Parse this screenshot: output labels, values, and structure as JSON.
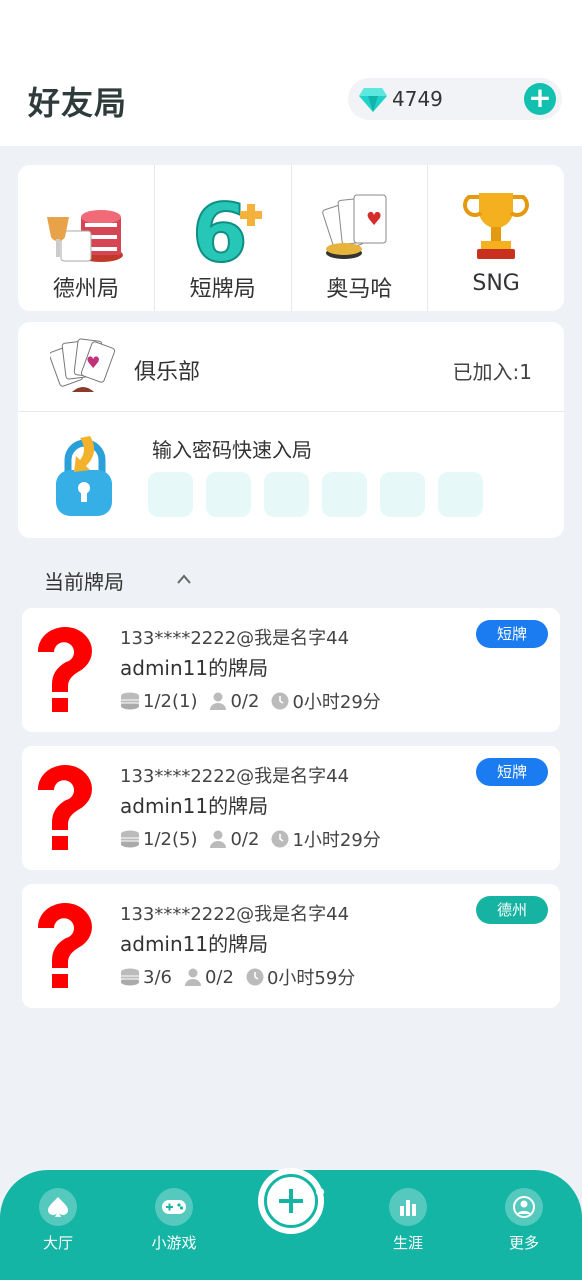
{
  "header": {
    "title": "好友局",
    "diamonds": "4749",
    "add_symbol": "+"
  },
  "game_types": [
    {
      "label": "德州局",
      "icon": "poker-chips-icon"
    },
    {
      "label": "短牌局",
      "icon": "six-plus-icon"
    },
    {
      "label": "奥马哈",
      "icon": "playing-cards-icon"
    },
    {
      "label": "SNG",
      "icon": "trophy-icon"
    }
  ],
  "club": {
    "label": "俱乐部",
    "joined": "已加入:1"
  },
  "password_entry": {
    "label": "输入密码快速入局",
    "box_count": 6
  },
  "current_tables": {
    "title": "当前牌局",
    "rooms": [
      {
        "owner": "133****2222@我是名字44",
        "name": "admin11的牌局",
        "blinds": "1/2(1)",
        "players": "0/2",
        "time": "0小时29分",
        "tag": "短牌",
        "tag_color": "#1a7cf0"
      },
      {
        "owner": "133****2222@我是名字44",
        "name": "admin11的牌局",
        "blinds": "1/2(5)",
        "players": "0/2",
        "time": "1小时29分",
        "tag": "短牌",
        "tag_color": "#1a7cf0"
      },
      {
        "owner": "133****2222@我是名字44",
        "name": "admin11的牌局",
        "blinds": "3/6",
        "players": "0/2",
        "time": "0小时59分",
        "tag": "德州",
        "tag_color": "#17b3a2"
      }
    ]
  },
  "tabbar": {
    "lobby": "大厅",
    "minigames": "小游戏",
    "career": "生涯",
    "more": "更多"
  },
  "colors": {
    "accent": "#14b5a5",
    "short_tag": "#1a7cf0",
    "texas_tag": "#17b3a2"
  }
}
